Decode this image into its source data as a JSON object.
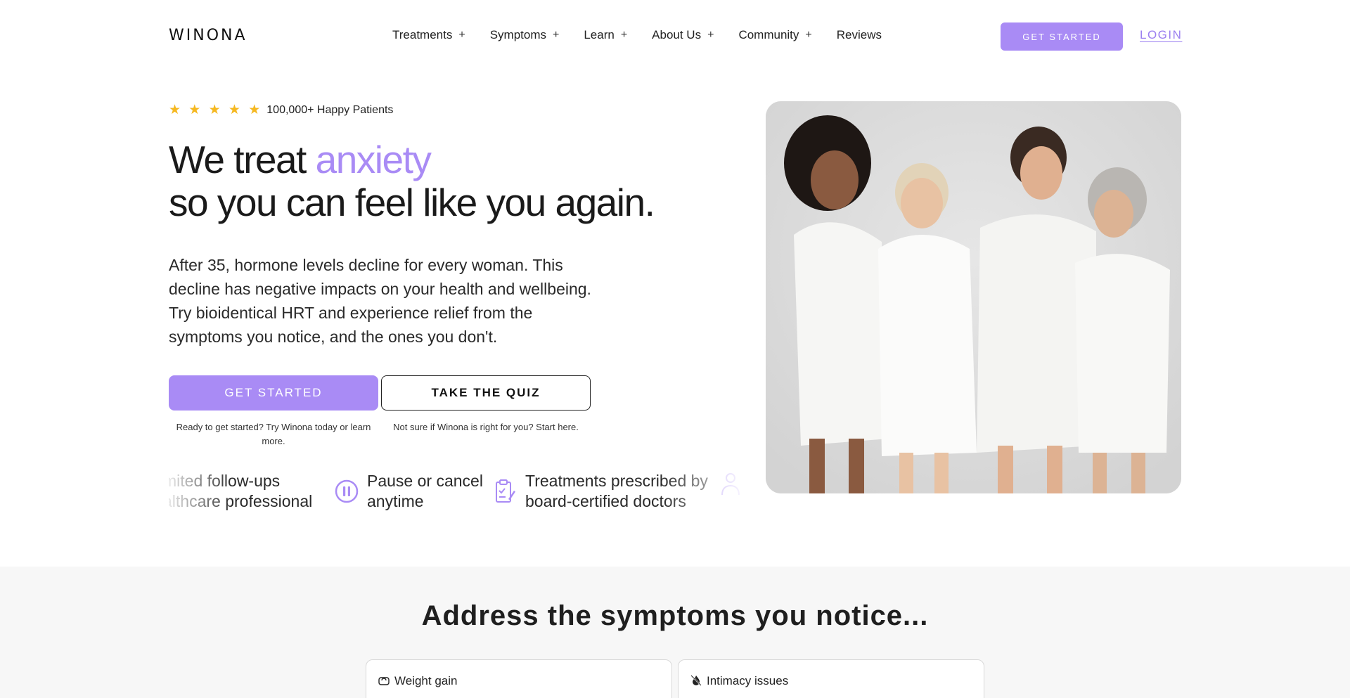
{
  "header": {
    "logo": "WINONA",
    "nav": [
      {
        "label": "Treatments",
        "expand": "+"
      },
      {
        "label": "Symptoms",
        "expand": "+"
      },
      {
        "label": "Learn",
        "expand": "+"
      },
      {
        "label": "About Us",
        "expand": "+"
      },
      {
        "label": "Community",
        "expand": "+"
      },
      {
        "label": "Reviews",
        "expand": ""
      }
    ],
    "cta": "GET STARTED",
    "login": "LOGIN"
  },
  "hero": {
    "stars": "★ ★ ★ ★ ★",
    "rating_text": "100,000+ Happy Patients",
    "headline_part1": "We treat ",
    "headline_accent": "anxiety",
    "headline_line2": "so you can feel like you again.",
    "intro": "After 35, hormone levels decline for every woman. This decline has negative impacts on your health and wellbeing. Try bioidentical HRT and experience relief from the symptoms you notice, and the ones you don't.",
    "primary_button": "GET STARTED",
    "secondary_button": "TAKE THE QUIZ",
    "primary_caption": "Ready to get started? Try Winona today or learn more.",
    "secondary_caption": "Not sure if Winona is right for you? Start here."
  },
  "benefits": [
    {
      "text_line1": "mited follow-ups",
      "text_line2": "althcare professional",
      "icon": "chat-icon"
    },
    {
      "text_line1": "Pause or cancel",
      "text_line2": "anytime",
      "icon": "pause-icon"
    },
    {
      "text_line1": "Treatments prescribed by",
      "text_line2": "board-certified doctors",
      "icon": "clipboard-icon"
    },
    {
      "text_line1": "",
      "text_line2": "",
      "icon": "doctor-icon"
    }
  ],
  "symptoms_section": {
    "title": "Address the symptoms you notice...",
    "cards": [
      {
        "label": "Weight gain",
        "icon": "scale-icon"
      },
      {
        "label": "Intimacy issues",
        "icon": "flame-off-icon"
      }
    ]
  },
  "colors": {
    "accent": "#a98bf5",
    "star": "#f5b820",
    "section_bg": "#f7f7f7"
  }
}
